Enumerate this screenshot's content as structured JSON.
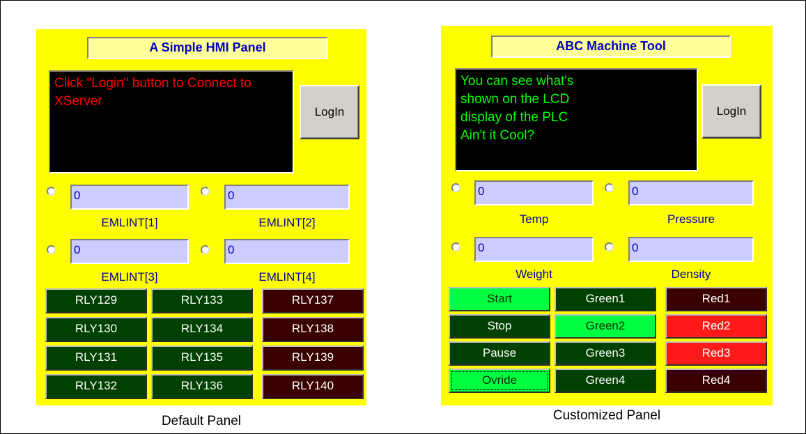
{
  "colors": {
    "panel_bg": "#ffff00",
    "green_off": "#004000",
    "green_on": "#00ff40",
    "red_off": "#3a0000",
    "red_on": "#ff1a1a",
    "lcd_red_text": "#ff0000",
    "lcd_green_text": "#00ff00"
  },
  "left": {
    "title": "A Simple HMI Panel",
    "lcd_text": "Click \"Login\" button to Connect to XServer",
    "login_label": "LogIn",
    "fields": [
      {
        "value": "0",
        "label": "EMLINT[1]"
      },
      {
        "value": "0",
        "label": "EMLINT[2]"
      },
      {
        "value": "0",
        "label": "EMLINT[3]"
      },
      {
        "value": "0",
        "label": "EMLINT[4]"
      }
    ],
    "relays": [
      {
        "label": "RLY129",
        "state": "green_off"
      },
      {
        "label": "RLY133",
        "state": "green_off"
      },
      {
        "label": "RLY137",
        "state": "red_off"
      },
      {
        "label": "RLY130",
        "state": "green_off"
      },
      {
        "label": "RLY134",
        "state": "green_off"
      },
      {
        "label": "RLY138",
        "state": "red_off"
      },
      {
        "label": "RLY131",
        "state": "green_off"
      },
      {
        "label": "RLY135",
        "state": "green_off"
      },
      {
        "label": "RLY139",
        "state": "red_off"
      },
      {
        "label": "RLY132",
        "state": "green_off"
      },
      {
        "label": "RLY136",
        "state": "green_off"
      },
      {
        "label": "RLY140",
        "state": "red_off"
      }
    ],
    "caption": "Default Panel"
  },
  "right": {
    "title": "ABC Machine Tool",
    "lcd_text": "You can see what's\nshown on the LCD\ndisplay of the PLC\nAin't it Cool?",
    "login_label": "LogIn",
    "fields": [
      {
        "value": "0",
        "label": "Temp"
      },
      {
        "value": "0",
        "label": "Pressure"
      },
      {
        "value": "0",
        "label": "Weight"
      },
      {
        "value": "0",
        "label": "Density"
      }
    ],
    "relays": [
      {
        "label": "Start",
        "state": "green_on"
      },
      {
        "label": "Green1",
        "state": "green_off"
      },
      {
        "label": "Red1",
        "state": "red_off"
      },
      {
        "label": "Stop",
        "state": "green_off"
      },
      {
        "label": "Green2",
        "state": "green_on"
      },
      {
        "label": "Red2",
        "state": "red_on"
      },
      {
        "label": "Pause",
        "state": "green_off"
      },
      {
        "label": "Green3",
        "state": "green_off"
      },
      {
        "label": "Red3",
        "state": "red_on"
      },
      {
        "label": "Ovride",
        "state": "green_on"
      },
      {
        "label": "Green4",
        "state": "green_off"
      },
      {
        "label": "Red4",
        "state": "red_off"
      }
    ],
    "caption": "Customized Panel"
  }
}
